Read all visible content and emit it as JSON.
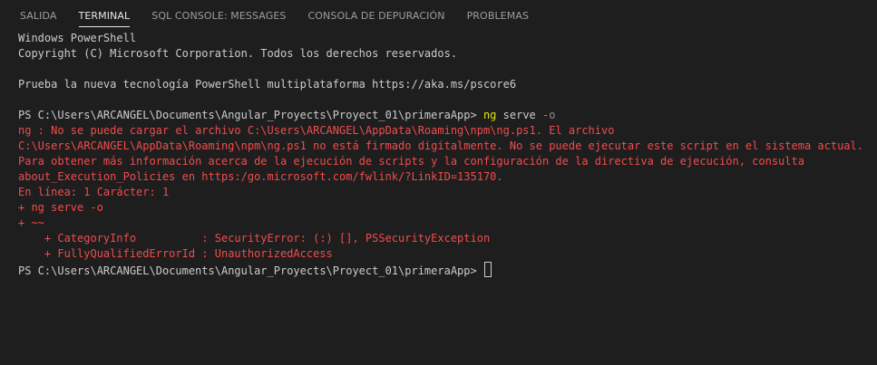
{
  "tabs": [
    {
      "label": "SALIDA",
      "active": false
    },
    {
      "label": "TERMINAL",
      "active": true
    },
    {
      "label": "SQL CONSOLE: MESSAGES",
      "active": false
    },
    {
      "label": "CONSOLA DE DEPURACIÓN",
      "active": false
    },
    {
      "label": "PROBLEMAS",
      "active": false
    }
  ],
  "terminal": {
    "header_line1": "Windows PowerShell",
    "header_line2": "Copyright (C) Microsoft Corporation. Todos los derechos reservados.",
    "promo_line": "Prueba la nueva tecnología PowerShell multiplataforma https://aka.ms/pscore6",
    "prompt": "PS C:\\Users\\ARCANGEL\\Documents\\Angular_Proyects\\Proyect_01\\primeraApp> ",
    "command": {
      "name": "ng",
      "args": "serve",
      "flag": "-o"
    },
    "error_lines": [
      "ng : No se puede cargar el archivo C:\\Users\\ARCANGEL\\AppData\\Roaming\\npm\\ng.ps1. El archivo",
      "C:\\Users\\ARCANGEL\\AppData\\Roaming\\npm\\ng.ps1 no está firmado digitalmente. No se puede ejecutar este script en el sistema actual.",
      "Para obtener más información acerca de la ejecución de scripts y la configuración de la directiva de ejecución, consulta",
      "about_Execution_Policies en https:/go.microsoft.com/fwlink/?LinkID=135170.",
      "En línea: 1 Carácter: 1",
      "+ ng serve -o",
      "+ ~~",
      "    + CategoryInfo          : SecurityError: (:) [], PSSecurityException",
      "    + FullyQualifiedErrorId : UnauthorizedAccess"
    ],
    "final_prompt": "PS C:\\Users\\ARCANGEL\\Documents\\Angular_Proyects\\Proyect_01\\primeraApp> "
  },
  "colors": {
    "background": "#1e1e1e",
    "text": "#cccccc",
    "error": "#f14c4c",
    "command": "#e5e510",
    "parameter": "#8c8c8c"
  }
}
